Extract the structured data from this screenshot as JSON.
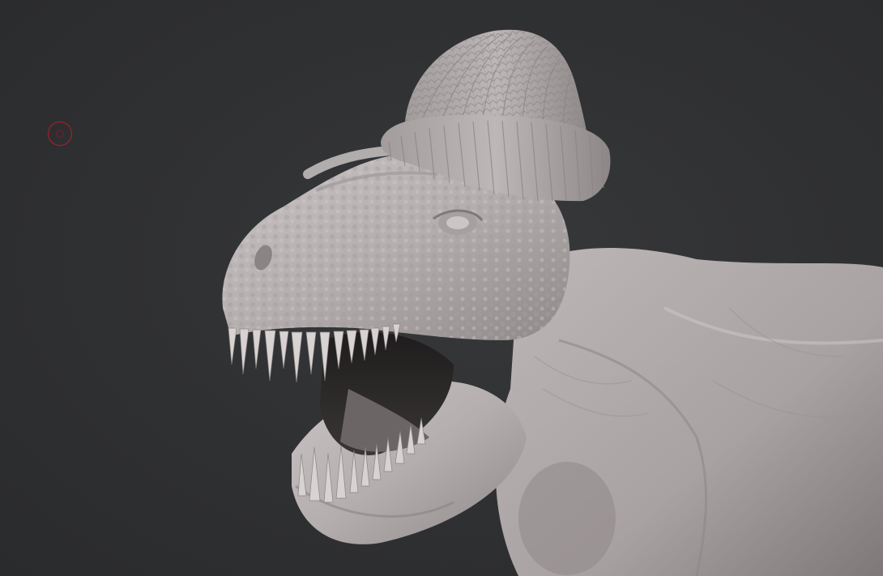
{
  "viewport": {
    "background": "#2e2f31",
    "model_name": "trex-with-beanie-sculpt",
    "material_color": "#b9b3b3",
    "shadow_color": "#4a4646"
  },
  "cursor": {
    "icon": "brush-cursor-icon",
    "color": "#b0202a"
  }
}
